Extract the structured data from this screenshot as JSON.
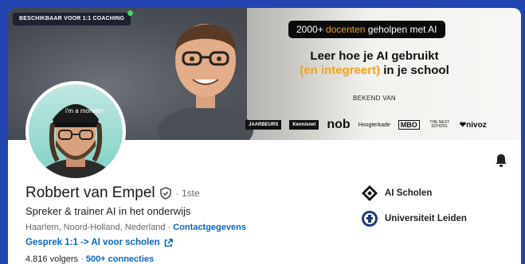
{
  "banner": {
    "coaching_badge": "BESCHIKBAAR VOOR 1:1 COACHING",
    "pill_prefix": "2000+ ",
    "pill_highlight": "docenten",
    "pill_suffix": " geholpen met AI",
    "headline_line1": "Leer hoe je AI gebruikt",
    "headline_line2_highlight": "(en integreert)",
    "headline_line2_suffix": " in je school",
    "known_from": "BEKEND VAN",
    "logos": [
      "JAARBEURS",
      "Kennisnet",
      "nob",
      "Hoogterkade",
      "MBO",
      "THE NEXT SCHOOL",
      "nivoz"
    ]
  },
  "profile": {
    "name": "Robbert van Empel",
    "degree": "· 1ste",
    "headline": "Spreker & trainer AI in het onderwijs",
    "location": "Haarlem, Noord-Holland, Nederland · ",
    "contact_link": "Contactgegevens",
    "cta_label": "Gesprek 1:1 -> AI voor scholen",
    "followers": "4.816 volgers",
    "separator": " · ",
    "connections": "500+ connecties",
    "avatar_cap_text": "i'm a monster"
  },
  "organizations": [
    {
      "name": "AI Scholen",
      "icon": "ai-scholen-logo"
    },
    {
      "name": "Universiteit Leiden",
      "icon": "leiden-seal"
    }
  ],
  "colors": {
    "link": "#0a66c2",
    "accent": "#f2a21a",
    "frame": "#2244b0"
  }
}
